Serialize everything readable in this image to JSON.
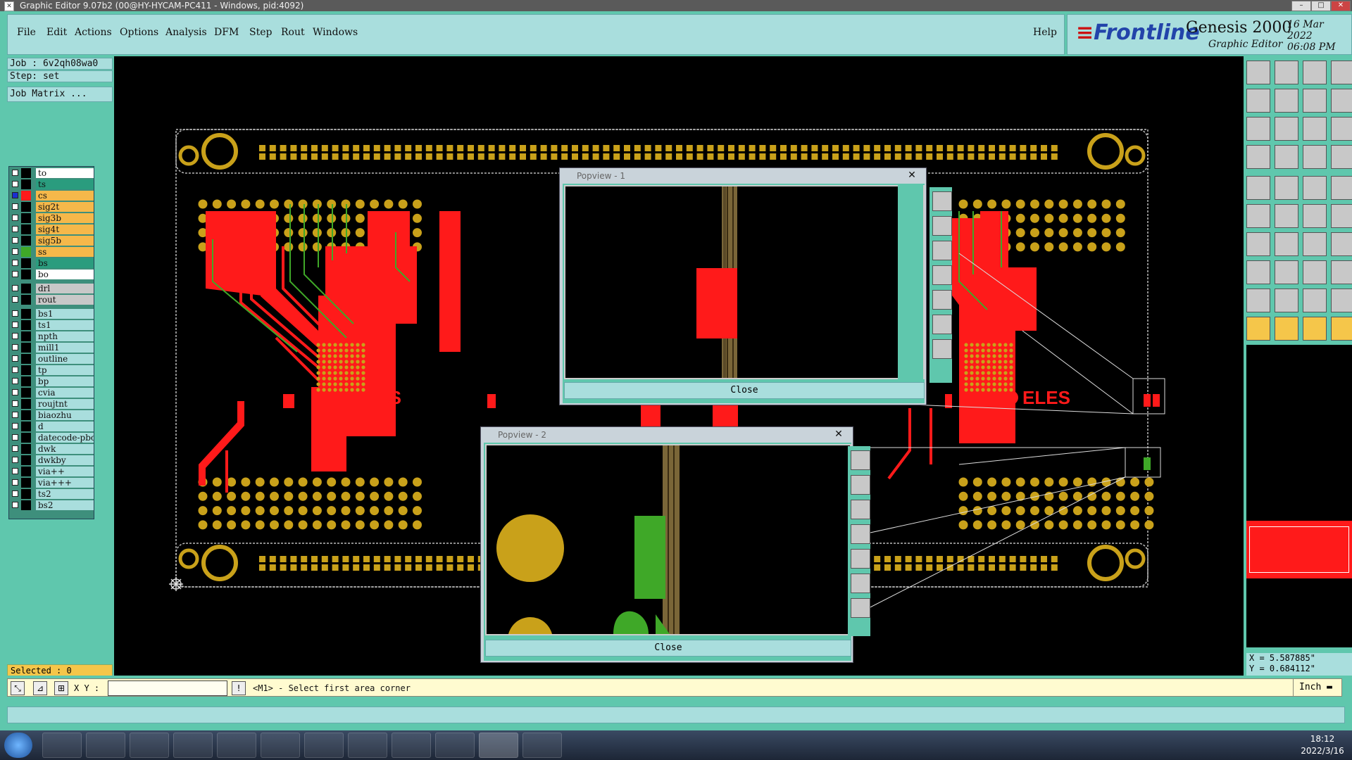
{
  "window": {
    "title": "Graphic Editor 9.07b2 (00@HY-HYCAM-PC411 - Windows, pid:4092)"
  },
  "menu": {
    "file": "File",
    "edit": "Edit",
    "actions": "Actions",
    "options": "Options",
    "analysis": "Analysis",
    "dfm": "DFM",
    "step": "Step",
    "rout": "Rout",
    "windows": "Windows",
    "help": "Help"
  },
  "brand": {
    "logo": "Frontline",
    "product": "Genesis 2000",
    "subtitle": "Graphic Editor",
    "date": "16 Mar 2022",
    "time": "06:08 PM"
  },
  "job": {
    "job": "Job : 6v2qh08wa0",
    "step": "Step: set",
    "matrix_button": "Job Matrix ..."
  },
  "layers": [
    {
      "name": "to",
      "color": "#ffffff",
      "swatch": "#000000"
    },
    {
      "name": "ts",
      "color": "#2a9c7e",
      "swatch": "#000000"
    },
    {
      "name": "cs",
      "color": "#f5b84a",
      "swatch": "#ff1a1a",
      "active": true
    },
    {
      "name": "sig2t",
      "color": "#f5b84a",
      "swatch": "#000000"
    },
    {
      "name": "sig3b",
      "color": "#f5b84a",
      "swatch": "#000000"
    },
    {
      "name": "sig4t",
      "color": "#f5b84a",
      "swatch": "#000000"
    },
    {
      "name": "sig5b",
      "color": "#f5b84a",
      "swatch": "#000000"
    },
    {
      "name": "ss",
      "color": "#f5b84a",
      "swatch": "#3fa828"
    },
    {
      "name": "bs",
      "color": "#2a9c7e",
      "swatch": "#000000"
    },
    {
      "name": "bo",
      "color": "#ffffff",
      "swatch": "#000000"
    },
    {
      "name": "drl",
      "color": "#c8c8c8",
      "swatch": "#000000",
      "group_gap": true
    },
    {
      "name": "rout",
      "color": "#c8c8c8",
      "swatch": "#000000"
    },
    {
      "name": "bs1",
      "color": "#a9dedd",
      "swatch": "#000000",
      "group_gap": true
    },
    {
      "name": "ts1",
      "color": "#a9dedd",
      "swatch": "#000000"
    },
    {
      "name": "npth",
      "color": "#a9dedd",
      "swatch": "#000000"
    },
    {
      "name": "mill1",
      "color": "#a9dedd",
      "swatch": "#000000"
    },
    {
      "name": "outline",
      "color": "#a9dedd",
      "swatch": "#000000"
    },
    {
      "name": "tp",
      "color": "#a9dedd",
      "swatch": "#000000"
    },
    {
      "name": "bp",
      "color": "#a9dedd",
      "swatch": "#000000"
    },
    {
      "name": "cvia",
      "color": "#a9dedd",
      "swatch": "#000000"
    },
    {
      "name": "roujtnt",
      "color": "#a9dedd",
      "swatch": "#000000"
    },
    {
      "name": "biaozhu",
      "color": "#a9dedd",
      "swatch": "#000000"
    },
    {
      "name": "d",
      "color": "#a9dedd",
      "swatch": "#000000"
    },
    {
      "name": "datecode-pbc",
      "color": "#a9dedd",
      "swatch": "#000000"
    },
    {
      "name": "dwk",
      "color": "#a9dedd",
      "swatch": "#000000"
    },
    {
      "name": "dwkby",
      "color": "#a9dedd",
      "swatch": "#000000"
    },
    {
      "name": "via++",
      "color": "#a9dedd",
      "swatch": "#000000"
    },
    {
      "name": "via+++",
      "color": "#a9dedd",
      "swatch": "#000000"
    },
    {
      "name": "ts2",
      "color": "#a9dedd",
      "swatch": "#000000"
    },
    {
      "name": "bs2",
      "color": "#a9dedd",
      "swatch": "#000000"
    }
  ],
  "selected": "Selected : 0",
  "canvas": {
    "board_text_left": "ELES",
    "board_text_right": "ELES"
  },
  "popview1": {
    "title": "Popview - 1",
    "close_label": "Close"
  },
  "popview2": {
    "title": "Popview - 2",
    "close_label": "Close"
  },
  "coords": {
    "x": "X = 5.587885\"",
    "y": "Y = 0.684112\""
  },
  "command": {
    "xy_label": "X Y :",
    "xy_value": "",
    "prompt": "<M1> - Select first area corner",
    "unit": "Inch"
  },
  "taskbar": {
    "time": "18:12",
    "date": "2022/3/16"
  },
  "colors": {
    "copper_red": "#ff1a1a",
    "pad_gold": "#c9a11a",
    "trace_green": "#3fa828",
    "panel_teal": "#5fc7ad"
  }
}
